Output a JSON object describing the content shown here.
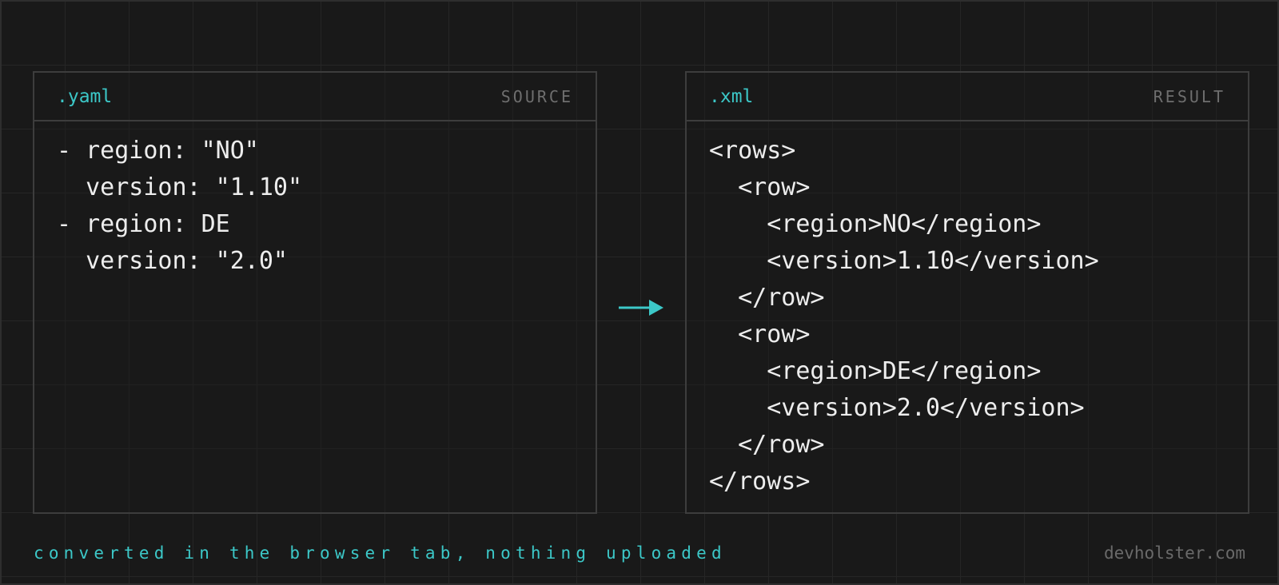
{
  "source": {
    "extension": ".yaml",
    "role": "SOURCE",
    "lines": [
      "- region: \"NO\"",
      "  version: \"1.10\"",
      "- region: DE",
      "  version: \"2.0\""
    ]
  },
  "result": {
    "extension": ".xml",
    "role": "RESULT",
    "lines": [
      "<rows>",
      "  <row>",
      "    <region>NO</region>",
      "    <version>1.10</version>",
      "  </row>",
      "  <row>",
      "    <region>DE</region>",
      "    <version>2.0</version>",
      "  </row>",
      "</rows>"
    ]
  },
  "footer": {
    "caption": "converted in the browser tab, nothing uploaded",
    "site": "devholster.com"
  },
  "colors": {
    "accent": "#3cc8c8",
    "background": "#191919",
    "text": "#ededed",
    "muted": "#6e6e6e"
  },
  "icons": {
    "arrow": "arrow-right-icon"
  }
}
